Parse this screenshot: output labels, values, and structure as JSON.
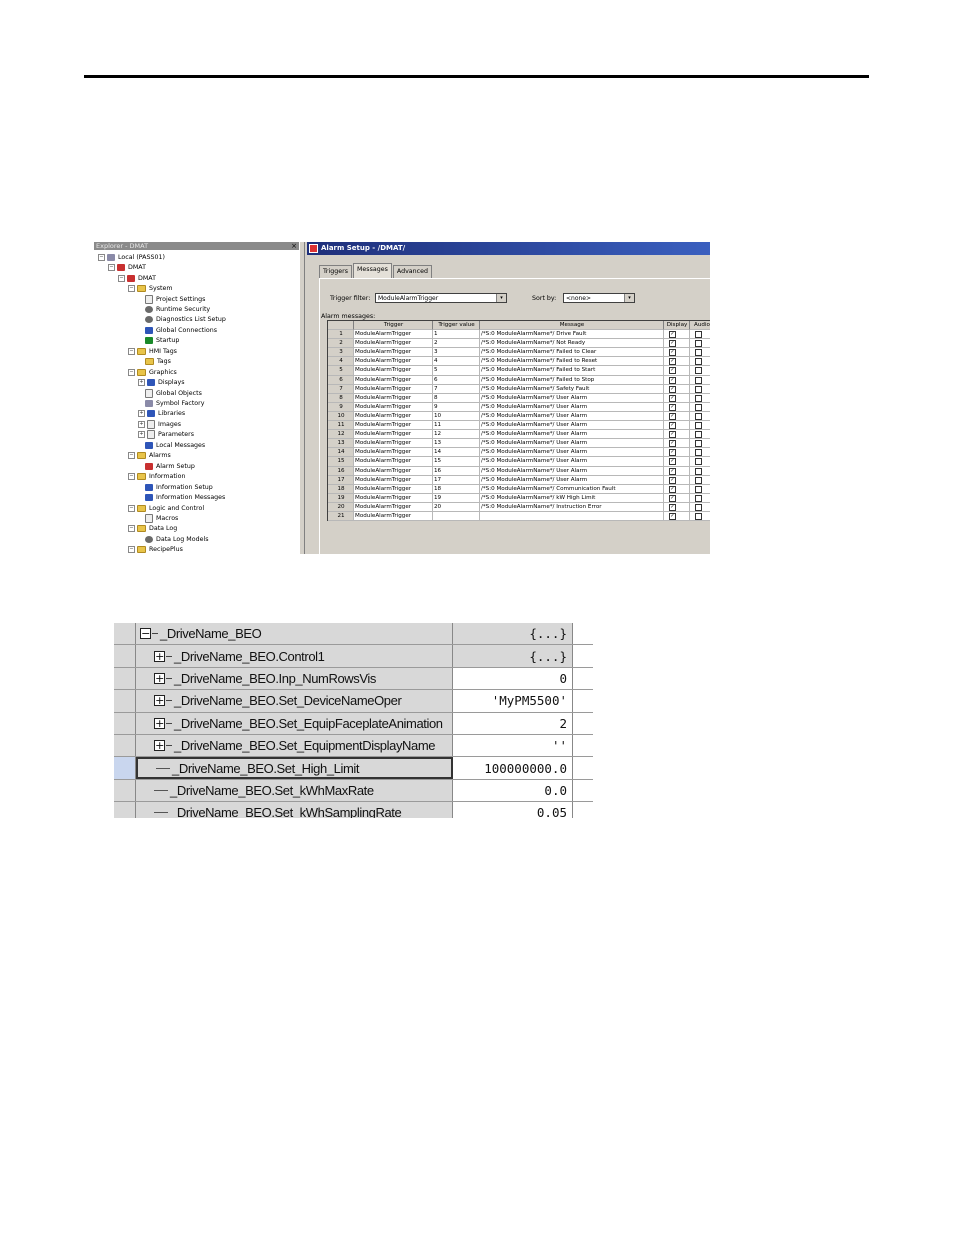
{
  "explorer": {
    "title": "Explorer - DMAT",
    "close": "×",
    "items": [
      {
        "label": "Local (PASS01)",
        "toggle": "−",
        "icon": "computer-icon"
      },
      {
        "label": "DMAT",
        "toggle": "−",
        "icon": "application-icon"
      },
      {
        "label": "DMAT",
        "toggle": "−",
        "icon": "area-icon"
      },
      {
        "label": "System",
        "toggle": "−",
        "icon": "folder-icon"
      },
      {
        "label": "Project Settings",
        "toggle": "",
        "icon": "settings-icon"
      },
      {
        "label": "Runtime Security",
        "toggle": "",
        "icon": "key-icon"
      },
      {
        "label": "Diagnostics List Setup",
        "toggle": "",
        "icon": "diagnostics-icon"
      },
      {
        "label": "Global Connections",
        "toggle": "",
        "icon": "globe-icon"
      },
      {
        "label": "Startup",
        "toggle": "",
        "icon": "flag-icon"
      },
      {
        "label": "HMI Tags",
        "toggle": "−",
        "icon": "folder-icon"
      },
      {
        "label": "Tags",
        "toggle": "",
        "icon": "tags-icon"
      },
      {
        "label": "Graphics",
        "toggle": "−",
        "icon": "folder-icon"
      },
      {
        "label": "Displays",
        "toggle": "+",
        "icon": "displays-icon"
      },
      {
        "label": "Global Objects",
        "toggle": "",
        "icon": "global-objects-icon"
      },
      {
        "label": "Symbol Factory",
        "toggle": "",
        "icon": "symbol-factory-icon"
      },
      {
        "label": "Libraries",
        "toggle": "+",
        "icon": "libraries-icon"
      },
      {
        "label": "Images",
        "toggle": "+",
        "icon": "images-icon"
      },
      {
        "label": "Parameters",
        "toggle": "+",
        "icon": "parameters-icon"
      },
      {
        "label": "Local Messages",
        "toggle": "",
        "icon": "local-messages-icon"
      },
      {
        "label": "Alarms",
        "toggle": "−",
        "icon": "folder-icon"
      },
      {
        "label": "Alarm Setup",
        "toggle": "",
        "icon": "alarm-icon"
      },
      {
        "label": "Information",
        "toggle": "−",
        "icon": "folder-icon"
      },
      {
        "label": "Information Setup",
        "toggle": "",
        "icon": "info-setup-icon"
      },
      {
        "label": "Information Messages",
        "toggle": "",
        "icon": "info-messages-icon"
      },
      {
        "label": "Logic and Control",
        "toggle": "−",
        "icon": "folder-icon"
      },
      {
        "label": "Macros",
        "toggle": "",
        "icon": "macros-icon"
      },
      {
        "label": "Data Log",
        "toggle": "−",
        "icon": "folder-icon"
      },
      {
        "label": "Data Log Models",
        "toggle": "",
        "icon": "data-log-icon"
      },
      {
        "label": "RecipePlus",
        "toggle": "−",
        "icon": "folder-icon"
      }
    ]
  },
  "alarm_setup": {
    "title": "Alarm Setup - /DMAT/",
    "tabs": [
      "Triggers",
      "Messages",
      "Advanced"
    ],
    "active_tab": "Messages",
    "trigger_filter_label": "Trigger filter:",
    "trigger_filter_value": "ModuleAlarmTrigger",
    "sort_by_label": "Sort by:",
    "sort_by_value": "<none>",
    "dropdown_arrow": "▾",
    "messages_label": "Alarm messages:",
    "columns": [
      "",
      "Trigger",
      "Trigger value",
      "Message",
      "Display",
      "Audio"
    ],
    "rows": [
      {
        "n": "1",
        "trigger": "ModuleAlarmTrigger",
        "value": "1",
        "message": "/*S:0 ModuleAlarmName*/ Drive Fault"
      },
      {
        "n": "2",
        "trigger": "ModuleAlarmTrigger",
        "value": "2",
        "message": "/*S:0 ModuleAlarmName*/ Not Ready"
      },
      {
        "n": "3",
        "trigger": "ModuleAlarmTrigger",
        "value": "3",
        "message": "/*S:0 ModuleAlarmName*/ Failed to Clear"
      },
      {
        "n": "4",
        "trigger": "ModuleAlarmTrigger",
        "value": "4",
        "message": "/*S:0 ModuleAlarmName*/ Failed to Reset"
      },
      {
        "n": "5",
        "trigger": "ModuleAlarmTrigger",
        "value": "5",
        "message": "/*S:0 ModuleAlarmName*/ Failed to Start"
      },
      {
        "n": "6",
        "trigger": "ModuleAlarmTrigger",
        "value": "6",
        "message": "/*S:0 ModuleAlarmName*/ Failed to Stop"
      },
      {
        "n": "7",
        "trigger": "ModuleAlarmTrigger",
        "value": "7",
        "message": "/*S:0 ModuleAlarmName*/ Safety Fault"
      },
      {
        "n": "8",
        "trigger": "ModuleAlarmTrigger",
        "value": "8",
        "message": "/*S:0 ModuleAlarmName*/ User Alarm"
      },
      {
        "n": "9",
        "trigger": "ModuleAlarmTrigger",
        "value": "9",
        "message": "/*S:0 ModuleAlarmName*/ User Alarm"
      },
      {
        "n": "10",
        "trigger": "ModuleAlarmTrigger",
        "value": "10",
        "message": "/*S:0 ModuleAlarmName*/ User Alarm"
      },
      {
        "n": "11",
        "trigger": "ModuleAlarmTrigger",
        "value": "11",
        "message": "/*S:0 ModuleAlarmName*/ User Alarm"
      },
      {
        "n": "12",
        "trigger": "ModuleAlarmTrigger",
        "value": "12",
        "message": "/*S:0 ModuleAlarmName*/ User Alarm"
      },
      {
        "n": "13",
        "trigger": "ModuleAlarmTrigger",
        "value": "13",
        "message": "/*S:0 ModuleAlarmName*/ User Alarm"
      },
      {
        "n": "14",
        "trigger": "ModuleAlarmTrigger",
        "value": "14",
        "message": "/*S:0 ModuleAlarmName*/ User Alarm"
      },
      {
        "n": "15",
        "trigger": "ModuleAlarmTrigger",
        "value": "15",
        "message": "/*S:0 ModuleAlarmName*/ User Alarm"
      },
      {
        "n": "16",
        "trigger": "ModuleAlarmTrigger",
        "value": "16",
        "message": "/*S:0 ModuleAlarmName*/ User Alarm"
      },
      {
        "n": "17",
        "trigger": "ModuleAlarmTrigger",
        "value": "17",
        "message": "/*S:0 ModuleAlarmName*/ User Alarm"
      },
      {
        "n": "18",
        "trigger": "ModuleAlarmTrigger",
        "value": "18",
        "message": "/*S:0 ModuleAlarmName*/ Communication Fault"
      },
      {
        "n": "19",
        "trigger": "ModuleAlarmTrigger",
        "value": "19",
        "message": "/*S:0 ModuleAlarmName*/ kW High Limit"
      },
      {
        "n": "20",
        "trigger": "ModuleAlarmTrigger",
        "value": "20",
        "message": "/*S:0 ModuleAlarmName*/ Instruction Error"
      },
      {
        "n": "21",
        "trigger": "ModuleAlarmTrigger",
        "value": "",
        "message": ""
      }
    ]
  },
  "tag_table": {
    "rows": [
      {
        "name": "_DriveName_BEO",
        "value": "{...}",
        "expander": "−",
        "level": 0,
        "value_grey": true,
        "selected": false
      },
      {
        "name": "_DriveName_BEO.Control1",
        "value": "{...}",
        "expander": "+",
        "level": 1,
        "value_grey": true,
        "selected": false
      },
      {
        "name": "_DriveName_BEO.Inp_NumRowsVis",
        "value": "0",
        "expander": "+",
        "level": 1,
        "value_grey": false,
        "selected": false
      },
      {
        "name": "_DriveName_BEO.Set_DeviceNameOper",
        "value": "'MyPM5500'",
        "expander": "+",
        "level": 1,
        "value_grey": false,
        "selected": false
      },
      {
        "name": "_DriveName_BEO.Set_EquipFaceplateAnimation",
        "value": "2",
        "expander": "+",
        "level": 1,
        "value_grey": false,
        "selected": false
      },
      {
        "name": "_DriveName_BEO.Set_EquipmentDisplayName",
        "value": "''",
        "expander": "+",
        "level": 1,
        "value_grey": false,
        "selected": false
      },
      {
        "name": "_DriveName_BEO.Set_High_Limit",
        "value": "100000000.0",
        "expander": "",
        "level": 1,
        "value_grey": false,
        "selected": true
      },
      {
        "name": "_DriveName_BEO.Set_kWhMaxRate",
        "value": "0.0",
        "expander": "",
        "level": 1,
        "value_grey": false,
        "selected": false
      },
      {
        "name": "_DriveName_BEO.Set_kWhSamplingRate",
        "value": "0.05",
        "expander": "",
        "level": 1,
        "value_grey": false,
        "selected": false
      }
    ]
  }
}
